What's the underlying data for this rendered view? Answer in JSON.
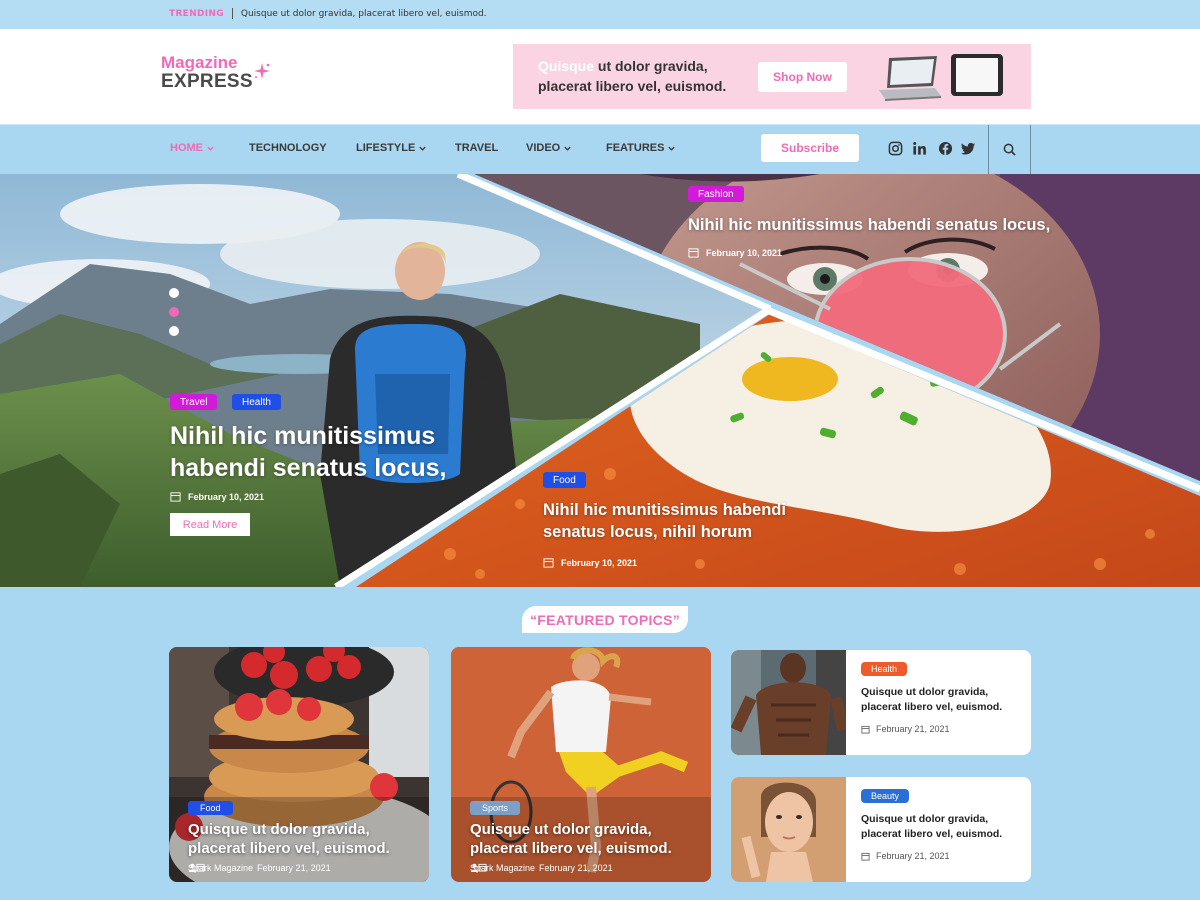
{
  "trending": {
    "label": "TRENDING",
    "text": "Quisque ut dolor gravida, placerat libero vel, euismod."
  },
  "logo": {
    "line1": "Magazine",
    "line2": "EXPRESS"
  },
  "ad": {
    "highlight": "Quisque",
    "text": "ut dolor gravida, placerat libero vel, euismod.",
    "button": "Shop Now"
  },
  "nav": {
    "items": [
      {
        "label": "HOME",
        "dropdown": true,
        "active": true
      },
      {
        "label": "TECHNOLOGY",
        "dropdown": false
      },
      {
        "label": "LIFESTYLE",
        "dropdown": true
      },
      {
        "label": "TRAVEL",
        "dropdown": false
      },
      {
        "label": "VIDEO",
        "dropdown": true
      },
      {
        "label": "FEATURES",
        "dropdown": true
      }
    ],
    "subscribe": "Subscribe",
    "social": [
      "instagram-icon",
      "linkedin-icon",
      "facebook-icon",
      "twitter-icon"
    ]
  },
  "hero": {
    "main": {
      "tags": [
        "Travel",
        "Health"
      ],
      "title_line1": "Nihil hic munitissimus",
      "title_line2": "habendi senatus locus,",
      "date": "February 10, 2021",
      "read_more": "Read More"
    },
    "top_right": {
      "tag": "Fashion",
      "title": "Nihil hic munitissimus habendi senatus locus,",
      "date": "February 10, 2021"
    },
    "bottom": {
      "tag": "Food",
      "title_line1": "Nihil hic munitissimus habendi",
      "title_line2": "senatus locus, nihil horum",
      "date": "February 10, 2021"
    },
    "slides": 3,
    "active_slide": 2
  },
  "featured": {
    "heading": "“FEATURED TOPICS”",
    "big_cards": [
      {
        "tag": "Food",
        "title": "Quisque ut dolor gravida, placerat libero vel, euismod.",
        "author": "Spark Magazine",
        "date": "February 21, 2021"
      },
      {
        "tag": "Sports",
        "title": "Quisque ut dolor gravida, placerat libero vel, euismod.",
        "author": "Spark Magazine",
        "date": "February 21, 2021"
      }
    ],
    "small_cards": [
      {
        "tag": "Health",
        "title": "Quisque ut dolor gravida, placerat libero vel, euismod.",
        "date": "February 21, 2021"
      },
      {
        "tag": "Beauty",
        "title": "Quisque ut dolor gravida, placerat libero vel, euismod.",
        "date": "February 21, 2021"
      }
    ]
  },
  "colors": {
    "accent_pink": "#f06bb5",
    "sky_blue": "#a9d6f0",
    "tag_magenta": "#d21bd8",
    "tag_blue": "#1f4fe6",
    "tag_orange": "#ee5a2c",
    "tag_steel": "#7b9fc6",
    "tag_beauty": "#2b6fd6"
  }
}
